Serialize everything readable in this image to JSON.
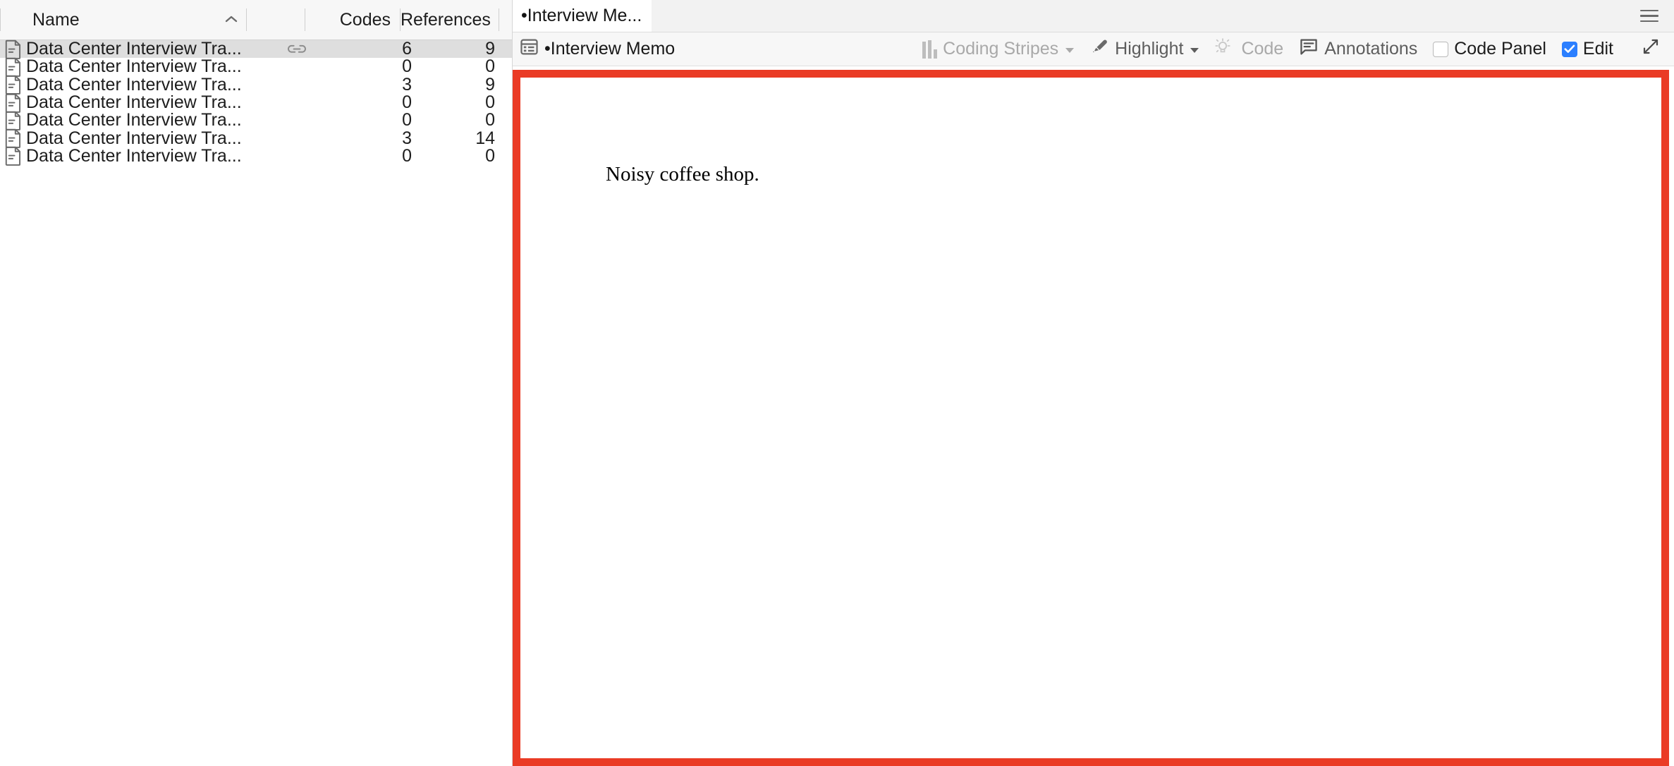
{
  "list_panel": {
    "columns": [
      {
        "key": "name",
        "label": "Name",
        "sort_indicator": "chevron-up"
      },
      {
        "key": "link",
        "label": ""
      },
      {
        "key": "codes",
        "label": "Codes"
      },
      {
        "key": "references",
        "label": "References"
      }
    ],
    "rows": [
      {
        "icon": "document-icon",
        "name": "Data Center Interview Tra...",
        "link": true,
        "codes": "6",
        "references": "9",
        "selected": true
      },
      {
        "icon": "document-icon",
        "name": "Data Center Interview Tra...",
        "link": false,
        "codes": "0",
        "references": "0",
        "selected": false
      },
      {
        "icon": "document-icon",
        "name": "Data Center Interview Tra...",
        "link": false,
        "codes": "3",
        "references": "9",
        "selected": false
      },
      {
        "icon": "document-icon",
        "name": "Data Center Interview Tra...",
        "link": false,
        "codes": "0",
        "references": "0",
        "selected": false
      },
      {
        "icon": "document-icon",
        "name": "Data Center Interview Tra...",
        "link": false,
        "codes": "0",
        "references": "0",
        "selected": false
      },
      {
        "icon": "document-icon",
        "name": "Data Center Interview Tra...",
        "link": false,
        "codes": "3",
        "references": "14",
        "selected": false
      },
      {
        "icon": "document-icon",
        "name": "Data Center Interview Tra...",
        "link": false,
        "codes": "0",
        "references": "0",
        "selected": false
      }
    ]
  },
  "detail_panel": {
    "tab": {
      "label": "•Interview Me...",
      "icon": "document-tab-icon"
    },
    "menu_icon": "hamburger-menu-icon",
    "toolbar": {
      "doc_title": "•Interview Memo",
      "doc_title_icon": "table-view-icon",
      "coding_stripes": {
        "label": "Coding Stripes",
        "icon": "coding-stripes-icon",
        "state": "disabled",
        "has_dropdown": true
      },
      "highlight": {
        "label": "Highlight",
        "icon": "highlighter-pen-icon",
        "state": "enabled",
        "has_dropdown": true
      },
      "code": {
        "label": "Code",
        "icon": "lightbulb-code-icon",
        "state": "disabled"
      },
      "annotations": {
        "label": "Annotations",
        "icon": "annotation-bubble-icon",
        "state": "enabled"
      },
      "code_panel": {
        "label": "Code Panel",
        "checked": false
      },
      "edit": {
        "label": "Edit",
        "checked": true
      },
      "expand": {
        "icon": "expand-diagonal-icon"
      }
    },
    "content": {
      "body_text": "Noisy coffee shop."
    }
  },
  "highlight_box": {
    "color": "#EA3B25",
    "border_width": "11px"
  },
  "colors": {
    "accent_red": "#EA3B25",
    "checkbox_blue": "#2B7FFF",
    "selected_row": "#DEDEDE",
    "header_bg": "#F7F7F7",
    "tabstrip_bg": "#F2F2F2"
  }
}
